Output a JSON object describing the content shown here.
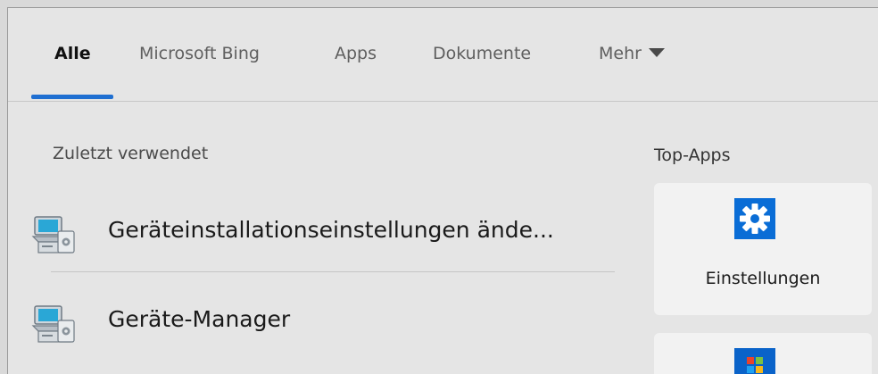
{
  "tabs": [
    {
      "label": "Alle",
      "active": true
    },
    {
      "label": "Microsoft Bing",
      "active": false
    },
    {
      "label": "Apps",
      "active": false
    },
    {
      "label": "Dokumente",
      "active": false
    },
    {
      "label": "Mehr",
      "active": false,
      "has_dropdown": true
    }
  ],
  "recent": {
    "title": "Zuletzt verwendet",
    "items": [
      {
        "label": "Geräteinstallationseinstellungen ände...",
        "icon": "device-installation-icon"
      },
      {
        "label": "Geräte-Manager",
        "icon": "device-manager-icon"
      }
    ]
  },
  "top_apps": {
    "title": "Top-Apps",
    "items": [
      {
        "label": "Einstellungen",
        "icon": "settings-gear-icon"
      },
      {
        "label": "",
        "icon": "store-icon"
      }
    ]
  },
  "colors": {
    "accent": "#1f6fd1",
    "settings_icon_bg": "#0a6dd6",
    "panel_bg": "#e5e5e5",
    "tile_bg": "#f2f2f2"
  }
}
